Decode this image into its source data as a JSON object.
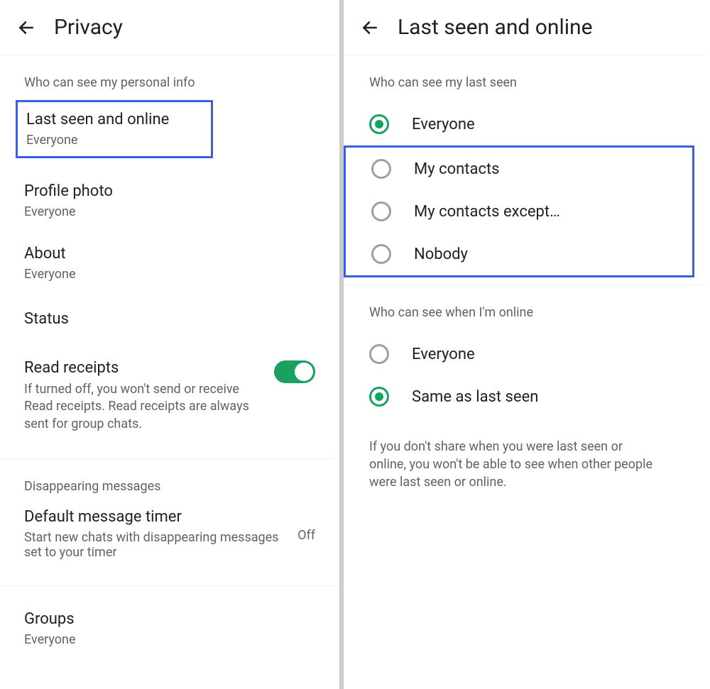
{
  "left": {
    "title": "Privacy",
    "section_personal": "Who can see my personal info",
    "items": {
      "last_seen": {
        "title": "Last seen and online",
        "value": "Everyone"
      },
      "profile_photo": {
        "title": "Profile photo",
        "value": "Everyone"
      },
      "about": {
        "title": "About",
        "value": "Everyone"
      },
      "status": {
        "title": "Status"
      }
    },
    "read_receipts": {
      "title": "Read receipts",
      "desc": "If turned off, you won't send or receive Read receipts. Read receipts are always sent for group chats.",
      "on": true
    },
    "section_disappearing": "Disappearing messages",
    "default_timer": {
      "title": "Default message timer",
      "desc": "Start new chats with disappearing messages set to your timer",
      "value": "Off"
    },
    "groups": {
      "title": "Groups",
      "value": "Everyone"
    }
  },
  "right": {
    "title": "Last seen and online",
    "section_last_seen": "Who can see my last seen",
    "last_seen_options": [
      {
        "label": "Everyone",
        "checked": true
      },
      {
        "label": "My contacts",
        "checked": false
      },
      {
        "label": "My contacts except…",
        "checked": false
      },
      {
        "label": "Nobody",
        "checked": false
      }
    ],
    "section_online": "Who can see when I'm online",
    "online_options": [
      {
        "label": "Everyone",
        "checked": false
      },
      {
        "label": "Same as last seen",
        "checked": true
      }
    ],
    "info": "If you don't share when you were last seen or online, you won't be able to see when other people were last seen or online."
  }
}
